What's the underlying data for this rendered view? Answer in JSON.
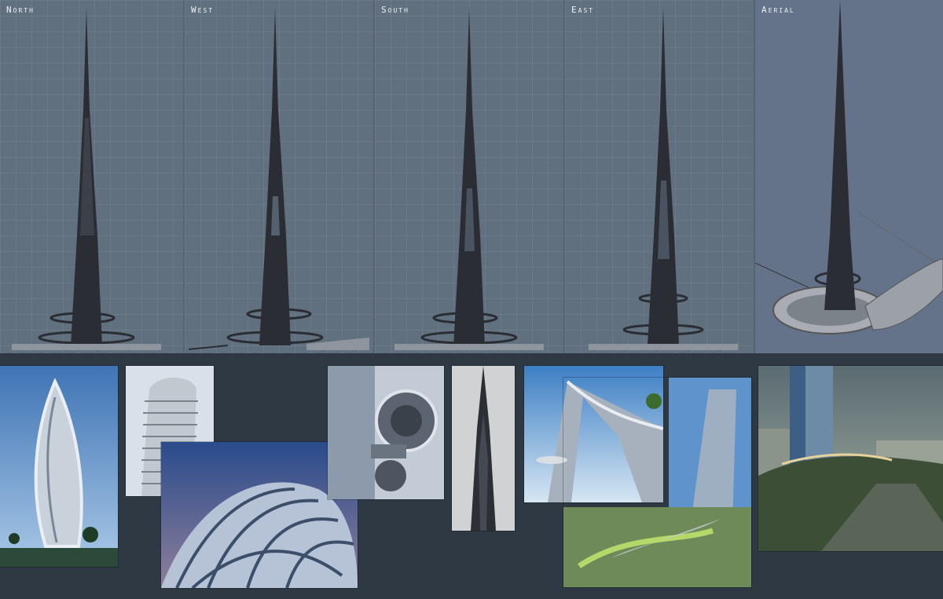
{
  "views": [
    {
      "label": "North"
    },
    {
      "label": "West"
    },
    {
      "label": "South"
    },
    {
      "label": "East"
    },
    {
      "label": "Aerial"
    }
  ],
  "colors": {
    "viewport_bg": "#61707f",
    "board_bg": "#2e3944",
    "tower": "#2a2d33",
    "label": "#eef1f5"
  },
  "reference_images": [
    "twisted-ribbon-tower",
    "stacked-balcony-tower",
    "lattice-shell-canopy",
    "glass-tower-with-sky-pod",
    "dark-spire-tower",
    "arched-tower-with-sky-garden",
    "curved-tower-with-green-podium",
    "night-city-landscape"
  ]
}
